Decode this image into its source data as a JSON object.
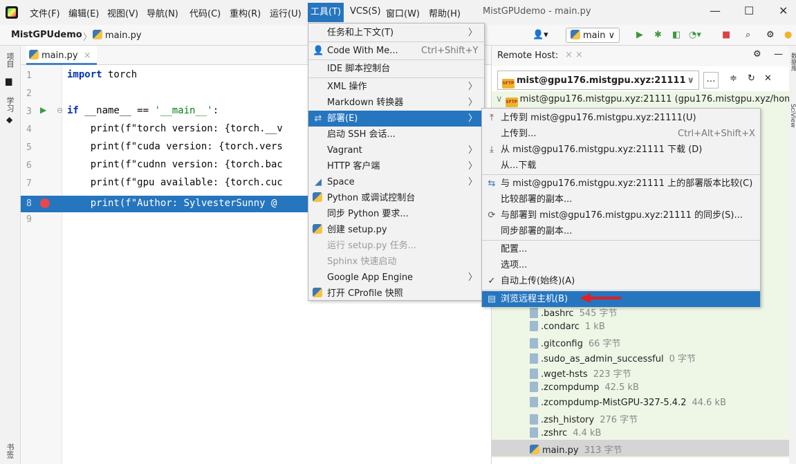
{
  "menubar": {
    "items": [
      "文件(F)",
      "编辑(E)",
      "视图(V)",
      "导航(N)",
      "代码(C)",
      "重构(R)",
      "运行(U)",
      "工具(T)",
      "VCS(S)",
      "窗口(W)",
      "帮助(H)"
    ],
    "window_title": "MistGPUdemo - main.py"
  },
  "navbar": {
    "project": "MistGPUdemo",
    "file": "main.py",
    "run_config": "main"
  },
  "left_strip": {
    "project_tab": "项目",
    "learn_tab": "学习",
    "bookmarks_tab": "书签"
  },
  "right_strip": {
    "database_tab": "数据库",
    "sciview_tab": "SciView"
  },
  "editor": {
    "tab_label": "main.py",
    "line_numbers": [
      "1",
      "2",
      "3",
      "4",
      "5",
      "6",
      "7",
      "8",
      "9"
    ],
    "lines": [
      {
        "kw": "import",
        "rest": " torch"
      },
      {
        "kw": "",
        "rest": ""
      },
      {
        "kw": "if",
        "rest": " __name__ == ",
        "str": "'__main__'",
        "tail": ":"
      },
      {
        "kw": "",
        "rest": "    print(f\"torch version: {torch.__v"
      },
      {
        "kw": "",
        "rest": "    print(f\"cuda version: {torch.vers"
      },
      {
        "kw": "",
        "rest": "    print(f\"cudnn version: {torch.bac"
      },
      {
        "kw": "",
        "rest": "    print(f\"gpu available: {torch.cuc"
      },
      {
        "kw": "",
        "rest": "    print(f\"Author: SylvesterSunny @"
      },
      {
        "kw": "",
        "rest": ""
      }
    ]
  },
  "tools_menu": {
    "items": [
      {
        "label": "任务和上下文(T)",
        "shortcut": "",
        "submenu": true,
        "disabled": false
      },
      {
        "label": "Code With Me...",
        "shortcut": "Ctrl+Shift+Y",
        "submenu": false,
        "disabled": false
      },
      {
        "label": "IDE 脚本控制台",
        "shortcut": "",
        "submenu": false,
        "disabled": false
      },
      {
        "label": "XML 操作",
        "shortcut": "",
        "submenu": true,
        "disabled": false
      },
      {
        "label": "Markdown 转换器",
        "shortcut": "",
        "submenu": true,
        "disabled": false
      },
      {
        "label": "部署(E)",
        "shortcut": "",
        "submenu": true,
        "disabled": false
      },
      {
        "label": "启动 SSH 会话...",
        "shortcut": "",
        "submenu": false,
        "disabled": false
      },
      {
        "label": "Vagrant",
        "shortcut": "",
        "submenu": true,
        "disabled": false
      },
      {
        "label": "HTTP 客户端",
        "shortcut": "",
        "submenu": true,
        "disabled": false
      },
      {
        "label": "Space",
        "shortcut": "",
        "submenu": true,
        "disabled": false
      },
      {
        "label": "Python 或调试控制台",
        "shortcut": "",
        "submenu": false,
        "disabled": false
      },
      {
        "label": "同步 Python 要求...",
        "shortcut": "",
        "submenu": false,
        "disabled": false
      },
      {
        "label": "创建 setup.py",
        "shortcut": "",
        "submenu": false,
        "disabled": false
      },
      {
        "label": "运行 setup.py 任务...",
        "shortcut": "",
        "submenu": false,
        "disabled": true
      },
      {
        "label": "Sphinx 快速启动",
        "shortcut": "",
        "submenu": false,
        "disabled": true
      },
      {
        "label": "Google App Engine",
        "shortcut": "",
        "submenu": true,
        "disabled": false
      },
      {
        "label": "打开 CProfile 快照",
        "shortcut": "",
        "submenu": false,
        "disabled": false
      }
    ]
  },
  "deploy_menu": {
    "items": [
      {
        "label": "上传到 mist@gpu176.mistgpu.xyz:21111(U)",
        "shortcut": ""
      },
      {
        "label": "上传到...",
        "shortcut": "Ctrl+Alt+Shift+X"
      },
      {
        "label": "从 mist@gpu176.mistgpu.xyz:21111 下载 (D)",
        "shortcut": ""
      },
      {
        "label": "从...下载",
        "shortcut": ""
      },
      {
        "label": "与 mist@gpu176.mistgpu.xyz:21111 上的部署版本比较(C)",
        "shortcut": ""
      },
      {
        "label": "比较部署的副本...",
        "shortcut": ""
      },
      {
        "label": "与部署到 mist@gpu176.mistgpu.xyz:21111 的同步(S)...",
        "shortcut": ""
      },
      {
        "label": "同步部署的副本...",
        "shortcut": ""
      },
      {
        "label": "配置...",
        "shortcut": ""
      },
      {
        "label": "选项...",
        "shortcut": ""
      },
      {
        "label": "自动上传(始终)(A)",
        "shortcut": ""
      },
      {
        "label": "浏览远程主机(B)",
        "shortcut": ""
      }
    ]
  },
  "remote_host": {
    "title": "Remote Host:",
    "host": "mist@gpu176.mistgpu.xyz:21111",
    "root_node": "mist@gpu176.mistgpu.xyz:21111 (gpu176.mistgpu.xyz/hom",
    "files": [
      {
        "name": ".bashrc",
        "size": "545 字节"
      },
      {
        "name": ".condarc",
        "size": "1 kB"
      },
      {
        "name": ".gitconfig",
        "size": "66 字节"
      },
      {
        "name": ".sudo_as_admin_successful",
        "size": "0 字节"
      },
      {
        "name": ".wget-hsts",
        "size": "223 字节"
      },
      {
        "name": ".zcompdump",
        "size": "42.5 kB"
      },
      {
        "name": ".zcompdump-MistGPU-327-5.4.2",
        "size": "44.6 kB"
      },
      {
        "name": ".zsh_history",
        "size": "276 字节"
      },
      {
        "name": ".zshrc",
        "size": "4.4 kB"
      },
      {
        "name": "main.py",
        "size": "313 字节"
      }
    ]
  },
  "colors": {
    "accent": "#2675bf",
    "tree_bg": "#eef6e6",
    "breakpoint": "#e5484d",
    "arrow": "#e02020"
  }
}
